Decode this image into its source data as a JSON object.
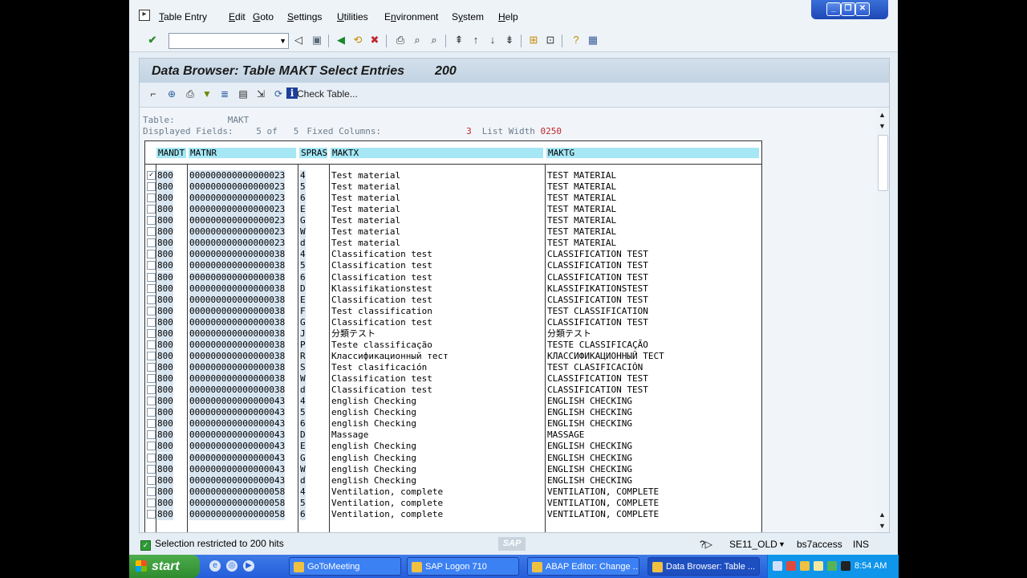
{
  "menu": [
    "Table Entry",
    "Edit",
    "Goto",
    "Settings",
    "Utilities",
    "Environment",
    "System",
    "Help"
  ],
  "menu_underline": [
    "T",
    "E",
    "G",
    "S",
    "U",
    "n",
    "y",
    "H"
  ],
  "window_controls": {
    "minimize": "_",
    "restore": "❐",
    "close": "✕"
  },
  "toolbar": {
    "command_field_value": ""
  },
  "panel": {
    "title": "Data Browser: Table MAKT Select Entries",
    "count": "200",
    "check_table_label": "Check Table..."
  },
  "info": {
    "table_label": "Table:",
    "table_value": "MAKT",
    "displayed_label": "Displayed Fields:",
    "displayed_value": "5",
    "of_label": "of",
    "total_value": "5",
    "fixed_label": "Fixed Columns:",
    "fixed_value": "3",
    "width_label": "List Width",
    "width_value": "0250"
  },
  "columns": [
    "MANDT",
    "MATNR",
    "SPRAS",
    "MAKTX",
    "MAKTG"
  ],
  "rows": [
    [
      "800",
      "000000000000000023",
      "4",
      "Test material",
      "TEST MATERIAL"
    ],
    [
      "800",
      "000000000000000023",
      "5",
      "Test material",
      "TEST MATERIAL"
    ],
    [
      "800",
      "000000000000000023",
      "6",
      "Test material",
      "TEST MATERIAL"
    ],
    [
      "800",
      "000000000000000023",
      "E",
      "Test material",
      "TEST MATERIAL"
    ],
    [
      "800",
      "000000000000000023",
      "G",
      "Test material",
      "TEST MATERIAL"
    ],
    [
      "800",
      "000000000000000023",
      "W",
      "Test material",
      "TEST MATERIAL"
    ],
    [
      "800",
      "000000000000000023",
      "d",
      "Test material",
      "TEST MATERIAL"
    ],
    [
      "800",
      "000000000000000038",
      "4",
      "Classification test",
      "CLASSIFICATION TEST"
    ],
    [
      "800",
      "000000000000000038",
      "5",
      "Classification test",
      "CLASSIFICATION TEST"
    ],
    [
      "800",
      "000000000000000038",
      "6",
      "Classification test",
      "CLASSIFICATION TEST"
    ],
    [
      "800",
      "000000000000000038",
      "D",
      "Klassifikationstest",
      "KLASSIFIKATIONSTEST"
    ],
    [
      "800",
      "000000000000000038",
      "E",
      "Classification test",
      "CLASSIFICATION TEST"
    ],
    [
      "800",
      "000000000000000038",
      "F",
      "Test classification",
      "TEST CLASSIFICATION"
    ],
    [
      "800",
      "000000000000000038",
      "G",
      "Classification test",
      "CLASSIFICATION TEST"
    ],
    [
      "800",
      "000000000000000038",
      "J",
      "分類テスト",
      "分類テスト"
    ],
    [
      "800",
      "000000000000000038",
      "P",
      "Teste classificação",
      "TESTE CLASSIFICAÇÃO"
    ],
    [
      "800",
      "000000000000000038",
      "R",
      "Классификационный тест",
      "КЛАССИФИКАЦИОННЫЙ ТЕСТ"
    ],
    [
      "800",
      "000000000000000038",
      "S",
      "Test clasificación",
      "TEST CLASIFICACIÓN"
    ],
    [
      "800",
      "000000000000000038",
      "W",
      "Classification test",
      "CLASSIFICATION TEST"
    ],
    [
      "800",
      "000000000000000038",
      "d",
      "Classification test",
      "CLASSIFICATION TEST"
    ],
    [
      "800",
      "000000000000000043",
      "4",
      "english Checking",
      "ENGLISH CHECKING"
    ],
    [
      "800",
      "000000000000000043",
      "5",
      "english Checking",
      "ENGLISH CHECKING"
    ],
    [
      "800",
      "000000000000000043",
      "6",
      "english Checking",
      "ENGLISH CHECKING"
    ],
    [
      "800",
      "000000000000000043",
      "D",
      "Massage",
      "MASSAGE"
    ],
    [
      "800",
      "000000000000000043",
      "E",
      "english Checking",
      "ENGLISH CHECKING"
    ],
    [
      "800",
      "000000000000000043",
      "G",
      "english Checking",
      "ENGLISH CHECKING"
    ],
    [
      "800",
      "000000000000000043",
      "W",
      "english Checking",
      "ENGLISH CHECKING"
    ],
    [
      "800",
      "000000000000000043",
      "d",
      "english Checking",
      "ENGLISH CHECKING"
    ],
    [
      "800",
      "000000000000000058",
      "4",
      "Ventilation, complete",
      "VENTILATION, COMPLETE"
    ],
    [
      "800",
      "000000000000000058",
      "5",
      "Ventilation, complete",
      "VENTILATION, COMPLETE"
    ],
    [
      "800",
      "000000000000000058",
      "6",
      "Ventilation, complete",
      "VENTILATION, COMPLETE"
    ]
  ],
  "checked_rows": [
    0
  ],
  "status": {
    "message": "Selection restricted to 200 hits",
    "sap_logo": "SAP",
    "transaction": "SE11_OLD",
    "server": "bs7access",
    "mode": "INS"
  },
  "taskbar": {
    "start_label": "start",
    "tasks": [
      "GoToMeeting",
      "SAP Logon 710",
      "ABAP Editor: Change ...",
      "Data Browser: Table ..."
    ],
    "active_task": 3,
    "clock": "8:54 AM"
  }
}
